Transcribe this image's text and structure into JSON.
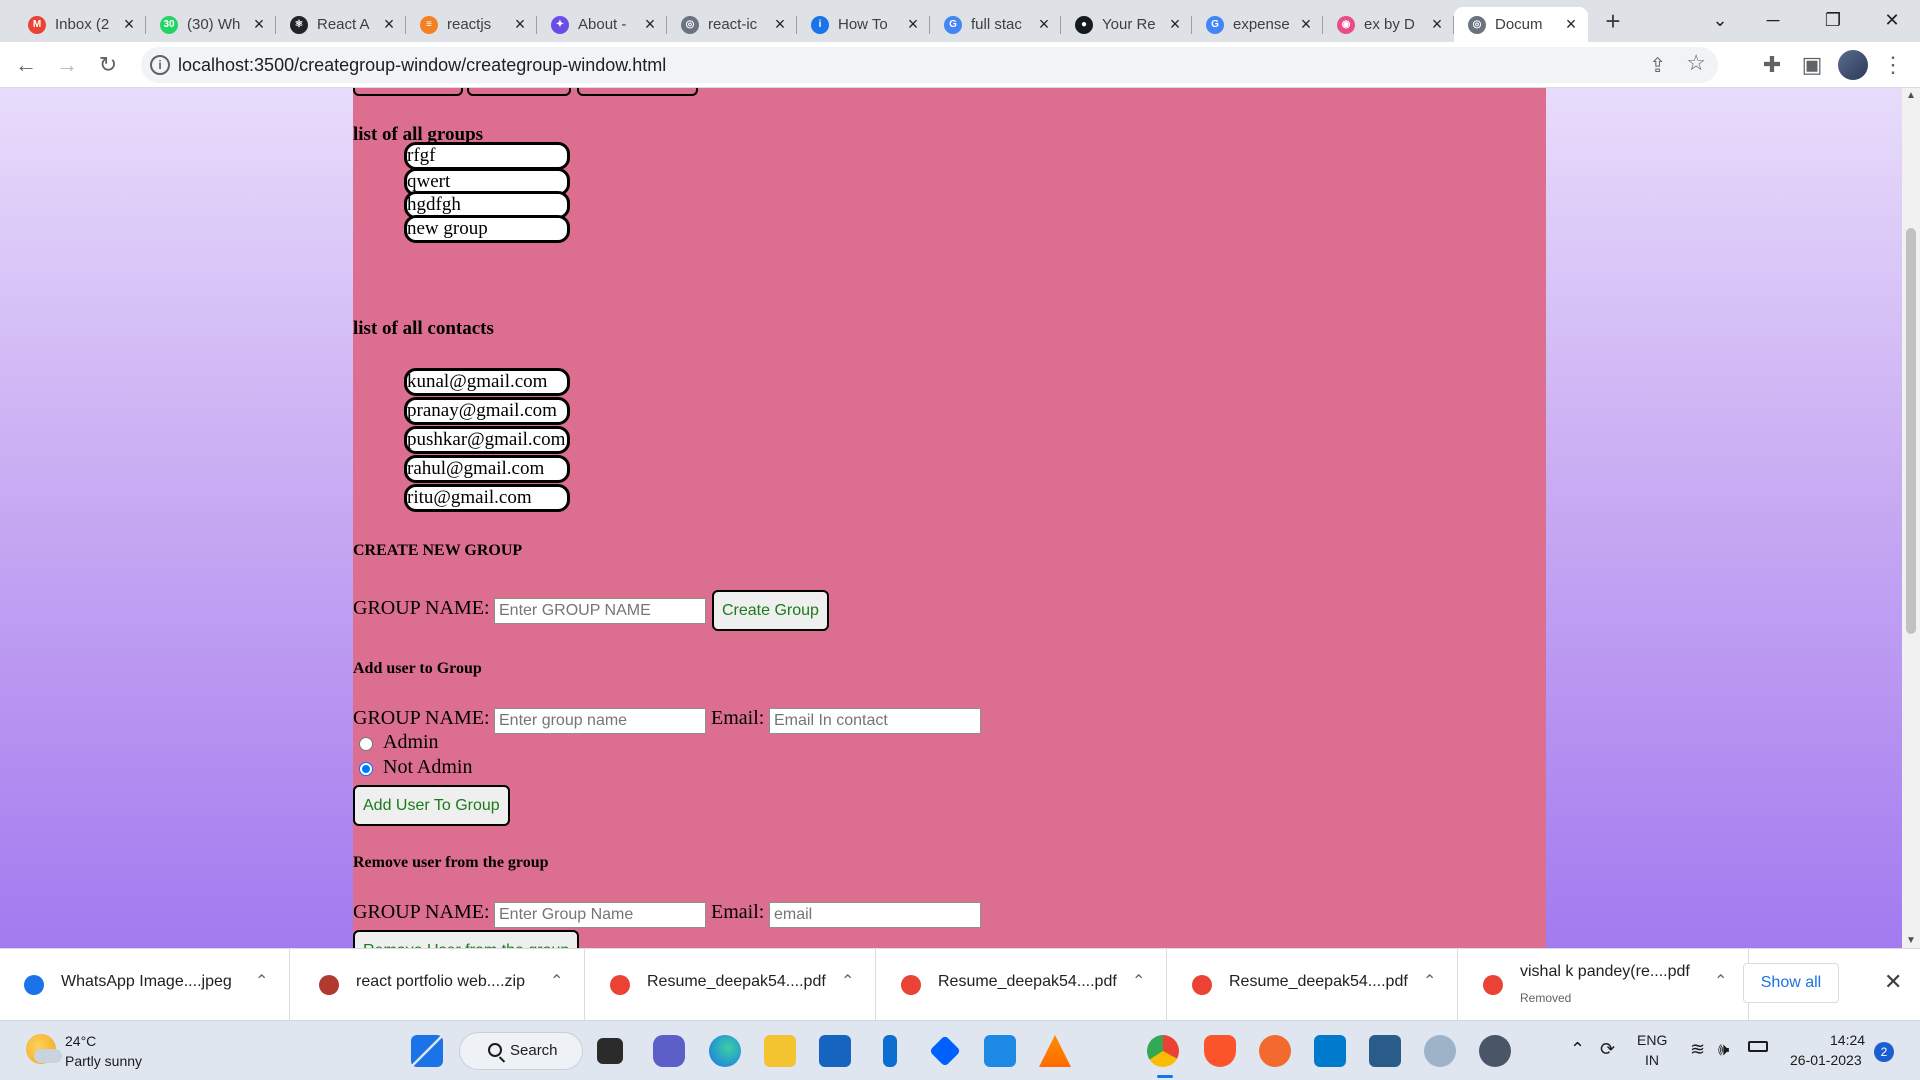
{
  "browser": {
    "tabs": [
      {
        "title": "Inbox (2",
        "icon": "gmail-icon",
        "color": "#ea4335",
        "glyph": "M"
      },
      {
        "title": "(30) Wh",
        "icon": "whatsapp-icon",
        "color": "#25d366",
        "glyph": "30"
      },
      {
        "title": "React A",
        "icon": "react-icon",
        "color": "#20232a",
        "glyph": "⚛"
      },
      {
        "title": "reactjs",
        "icon": "stackoverflow-icon",
        "color": "#f48024",
        "glyph": "≡"
      },
      {
        "title": "About -",
        "icon": "app-icon",
        "color": "#6b4ce6",
        "glyph": "✦"
      },
      {
        "title": "react-ic",
        "icon": "globe-icon",
        "color": "#6b7280",
        "glyph": "◎"
      },
      {
        "title": "How To",
        "icon": "info-icon",
        "color": "#1a73e8",
        "glyph": "i"
      },
      {
        "title": "full stac",
        "icon": "google-icon",
        "color": "#4285f4",
        "glyph": "G"
      },
      {
        "title": "Your Re",
        "icon": "github-icon",
        "color": "#161b22",
        "glyph": "●"
      },
      {
        "title": "expense",
        "icon": "google-icon",
        "color": "#4285f4",
        "glyph": "G"
      },
      {
        "title": "ex by D",
        "icon": "dribbble-icon",
        "color": "#ea4c89",
        "glyph": "◉"
      },
      {
        "title": "Docum",
        "icon": "globe-icon",
        "color": "#6b7280",
        "glyph": "◎",
        "active": true
      }
    ],
    "url": "localhost:3500/creategroup-window/creategroup-window.html"
  },
  "page": {
    "groups_heading": "list of all groups",
    "groups": [
      "rfgf",
      "qwert",
      "hgdfgh",
      "new group"
    ],
    "contacts_heading": "list of all contacts",
    "contacts": [
      "kunal@gmail.com",
      "pranay@gmail.com",
      "pushkar@gmail.com",
      "rahul@gmail.com",
      "ritu@gmail.com"
    ],
    "create": {
      "heading": "CREATE NEW GROUP",
      "label": "GROUP NAME:",
      "placeholder": "Enter GROUP NAME",
      "button": "Create Group"
    },
    "add_user": {
      "heading": "Add user to Group",
      "group_label": "GROUP NAME:",
      "group_placeholder": "Enter group name",
      "email_label": "Email:",
      "email_placeholder": "Email In contact",
      "radio_admin": "Admin",
      "radio_not_admin": "Not Admin",
      "selected": "Not Admin",
      "button": "Add User To Group"
    },
    "remove_user": {
      "heading": "Remove user from the group",
      "group_label": "GROUP NAME:",
      "group_placeholder": "Enter Group Name",
      "email_label": "Email:",
      "email_placeholder": "email",
      "button": "Remove User from the group"
    }
  },
  "downloads": {
    "items": [
      {
        "name": "WhatsApp Image....jpeg",
        "icon": "image-file-icon",
        "color": "#1a73e8"
      },
      {
        "name": "react portfolio web....zip",
        "icon": "zip-file-icon",
        "color": "#b03a2e"
      },
      {
        "name": "Resume_deepak54....pdf",
        "icon": "chrome-icon",
        "color": "#ea4335"
      },
      {
        "name": "Resume_deepak54....pdf",
        "icon": "chrome-icon",
        "color": "#ea4335"
      },
      {
        "name": "Resume_deepak54....pdf",
        "icon": "chrome-icon",
        "color": "#ea4335"
      },
      {
        "name": "vishal k pandey(re....pdf",
        "icon": "chrome-icon",
        "color": "#ea4335",
        "sub": "Removed"
      }
    ],
    "show_all": "Show all"
  },
  "taskbar": {
    "temperature": "24°C",
    "weather": "Partly sunny",
    "search": "Search",
    "language_top": "ENG",
    "language_bottom": "IN",
    "time": "14:24",
    "date": "26-01-2023",
    "notifications": "2"
  }
}
